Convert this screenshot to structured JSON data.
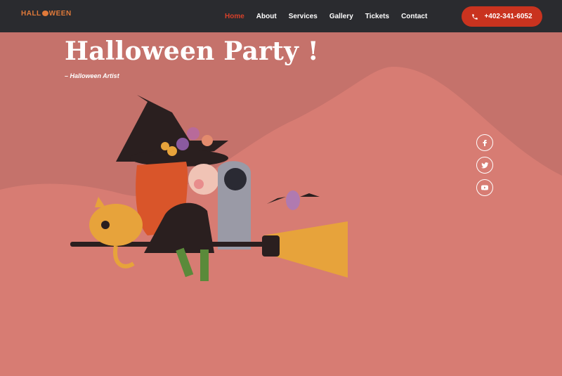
{
  "brand": {
    "logo_text": "HALL",
    "logo_text_end": "WEEN"
  },
  "nav": {
    "items": [
      {
        "label": "Home",
        "active": true
      },
      {
        "label": "About",
        "active": false
      },
      {
        "label": "Services",
        "active": false
      },
      {
        "label": "Gallery",
        "active": false
      },
      {
        "label": "Tickets",
        "active": false
      },
      {
        "label": "Contact",
        "active": false
      }
    ]
  },
  "contact": {
    "phone": "+402-341-6052",
    "icon": "phone-icon"
  },
  "hero": {
    "title": "Halloween Party !",
    "subtitle": "– Halloween Artist"
  },
  "social": [
    {
      "name": "facebook",
      "icon": "facebook-icon"
    },
    {
      "name": "twitter",
      "icon": "twitter-icon"
    },
    {
      "name": "youtube",
      "icon": "youtube-icon"
    }
  ],
  "colors": {
    "topbar": "#2a2b2f",
    "accent": "#c9331f",
    "active_nav": "#d7402a",
    "hero_bg": "#c5726b",
    "hill": "#d77c73"
  }
}
